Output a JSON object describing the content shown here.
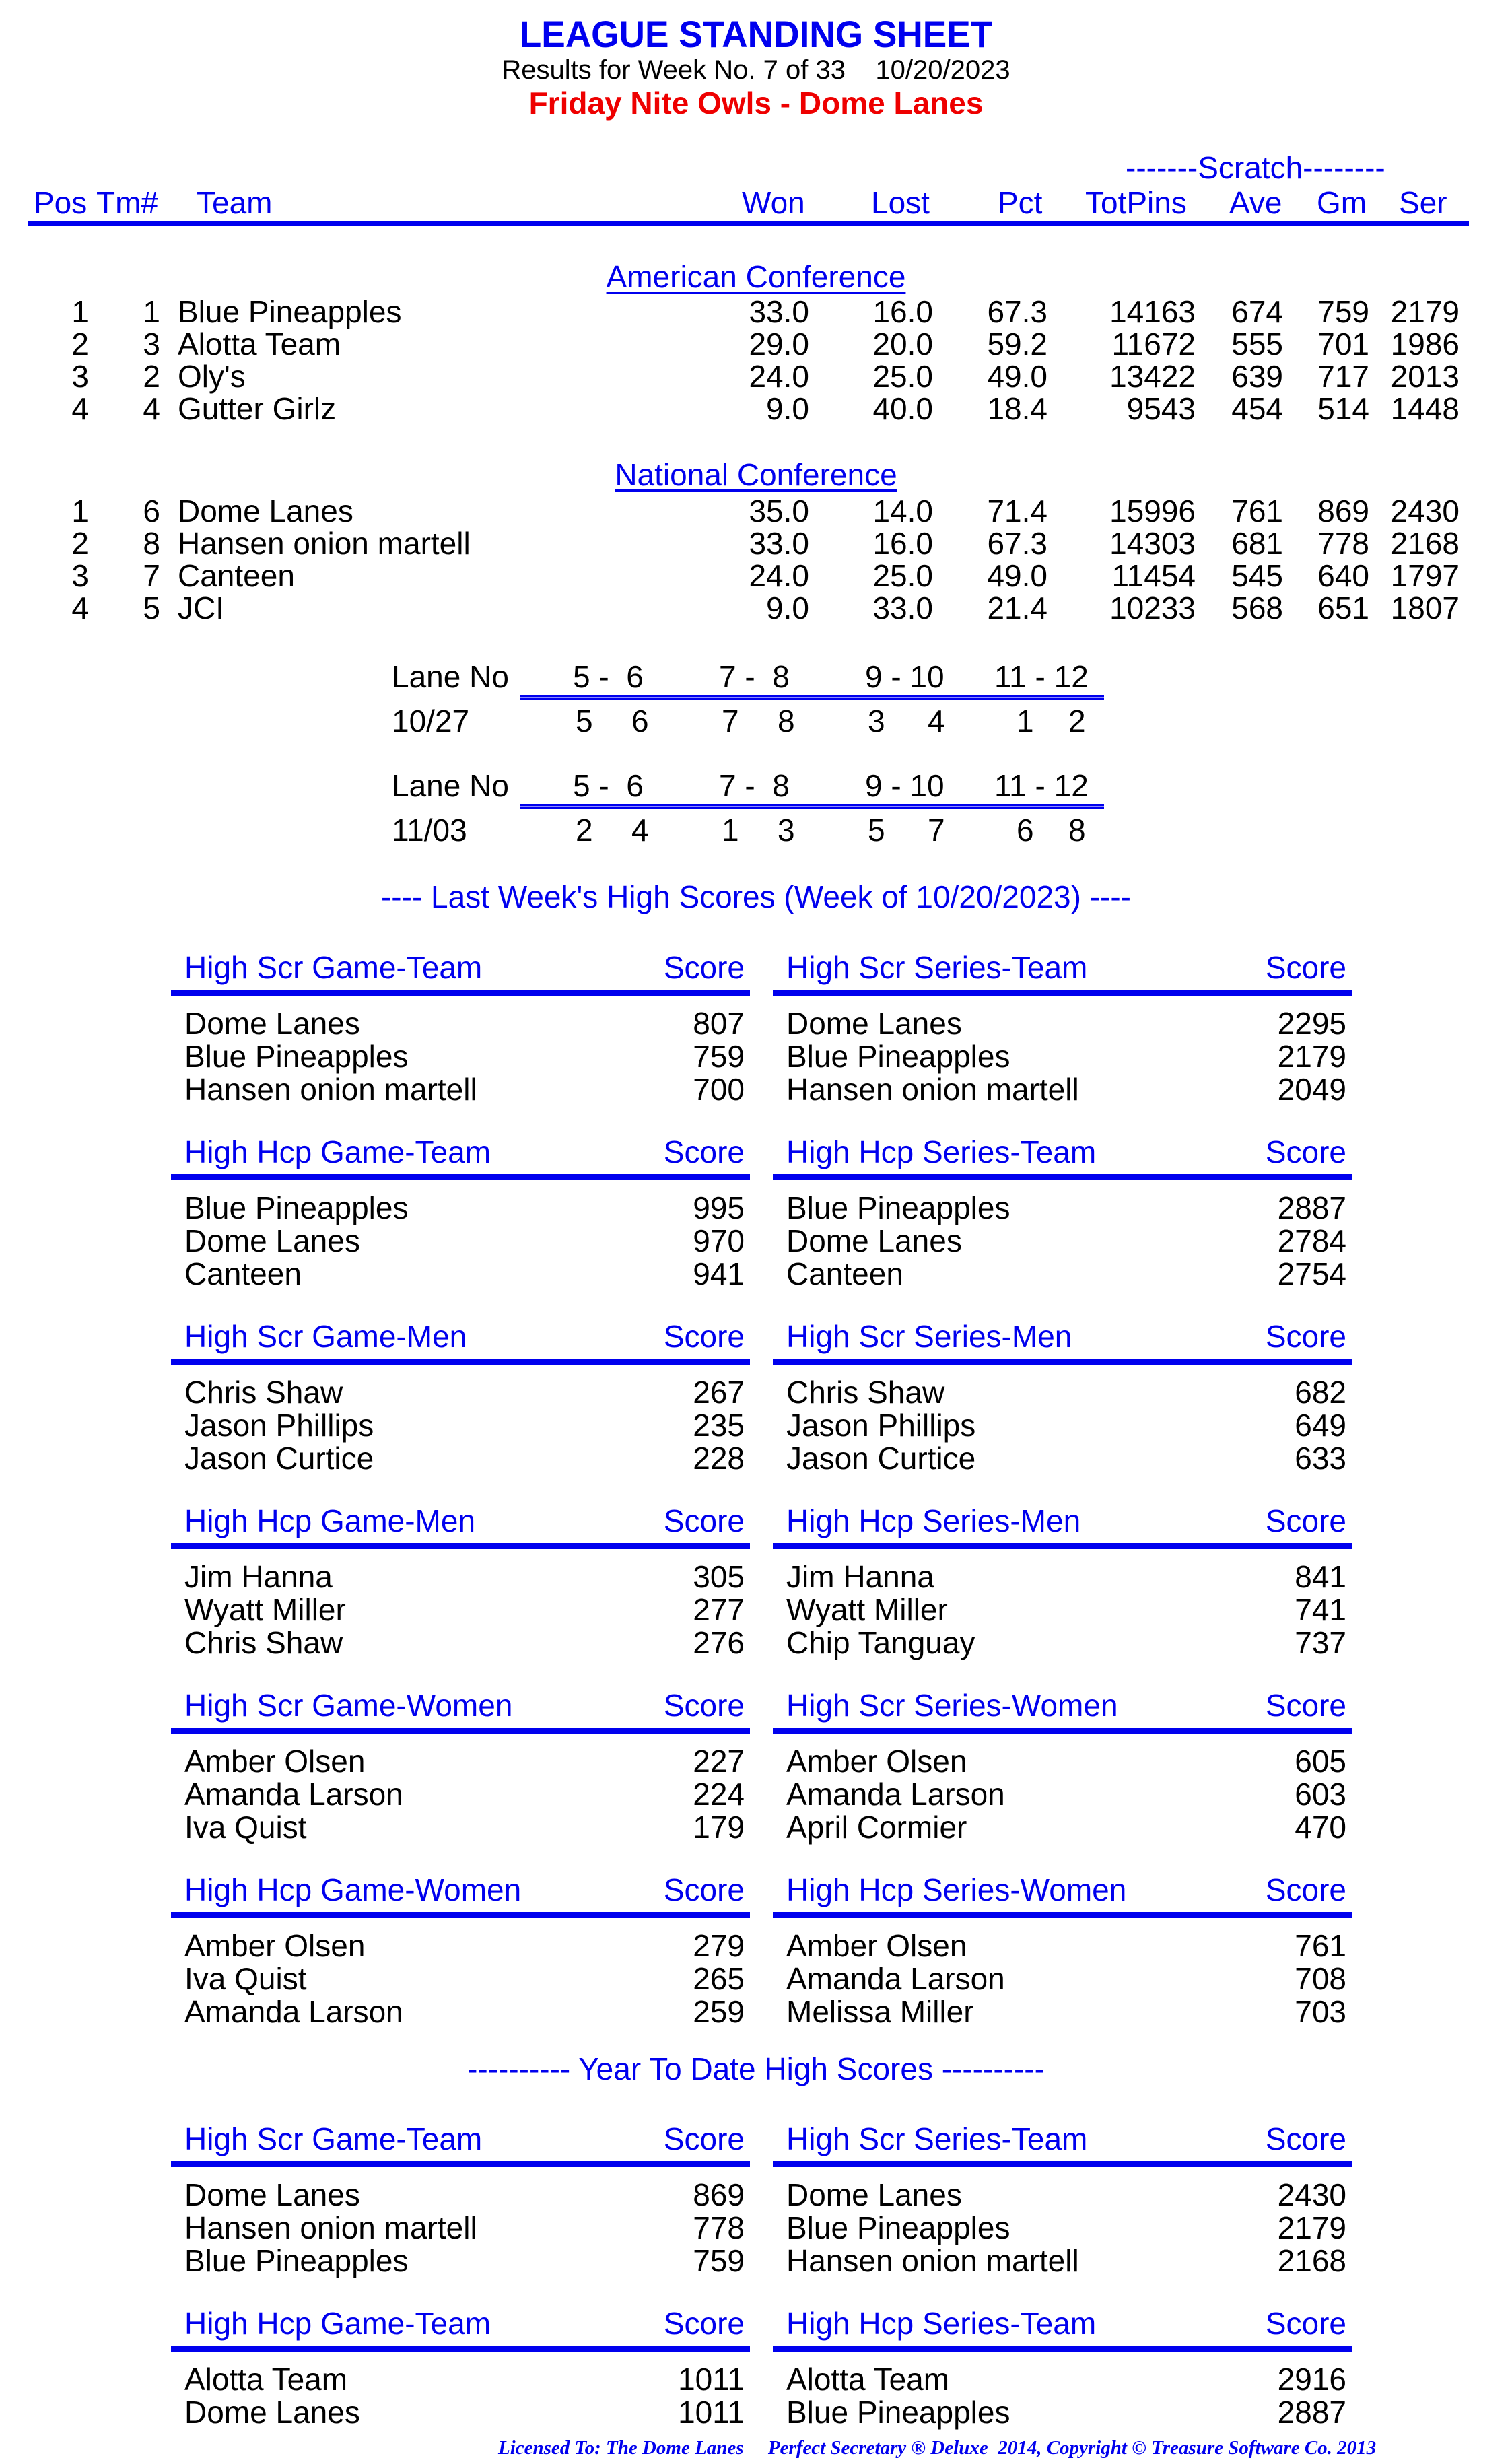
{
  "header": {
    "title": "LEAGUE STANDING SHEET",
    "subtitle": "Results for Week No. 7 of 33    10/20/2023",
    "league_name": "Friday Nite Owls - Dome Lanes"
  },
  "standings": {
    "scratch_label": "-------Scratch--------",
    "columns": {
      "pos": "Pos",
      "tm": "Tm#",
      "team": "Team",
      "won": "Won",
      "lost": "Lost",
      "pct": "Pct",
      "totpins": "TotPins",
      "ave": "Ave",
      "gm": "Gm",
      "ser": "Ser"
    },
    "conferences": [
      {
        "name": "American Conference",
        "rows": [
          {
            "pos": "1",
            "tm": "1",
            "team": "Blue Pineapples",
            "won": "33.0",
            "lost": "16.0",
            "pct": "67.3",
            "totpins": "14163",
            "ave": "674",
            "gm": "759",
            "ser": "2179"
          },
          {
            "pos": "2",
            "tm": "3",
            "team": "Alotta Team",
            "won": "29.0",
            "lost": "20.0",
            "pct": "59.2",
            "totpins": "11672",
            "ave": "555",
            "gm": "701",
            "ser": "1986"
          },
          {
            "pos": "3",
            "tm": "2",
            "team": "Oly's",
            "won": "24.0",
            "lost": "25.0",
            "pct": "49.0",
            "totpins": "13422",
            "ave": "639",
            "gm": "717",
            "ser": "2013"
          },
          {
            "pos": "4",
            "tm": "4",
            "team": "Gutter Girlz",
            "won": "9.0",
            "lost": "40.0",
            "pct": "18.4",
            "totpins": "9543",
            "ave": "454",
            "gm": "514",
            "ser": "1448"
          }
        ]
      },
      {
        "name": "National Conference",
        "rows": [
          {
            "pos": "1",
            "tm": "6",
            "team": "Dome Lanes",
            "won": "35.0",
            "lost": "14.0",
            "pct": "71.4",
            "totpins": "15996",
            "ave": "761",
            "gm": "869",
            "ser": "2430"
          },
          {
            "pos": "2",
            "tm": "8",
            "team": "Hansen onion martell",
            "won": "33.0",
            "lost": "16.0",
            "pct": "67.3",
            "totpins": "14303",
            "ave": "681",
            "gm": "778",
            "ser": "2168"
          },
          {
            "pos": "3",
            "tm": "7",
            "team": "Canteen",
            "won": "24.0",
            "lost": "25.0",
            "pct": "49.0",
            "totpins": "11454",
            "ave": "545",
            "gm": "640",
            "ser": "1797"
          },
          {
            "pos": "4",
            "tm": "5",
            "team": "JCI",
            "won": "9.0",
            "lost": "33.0",
            "pct": "21.4",
            "totpins": "10233",
            "ave": "568",
            "gm": "651",
            "ser": "1807"
          }
        ]
      }
    ]
  },
  "lane_assignments": [
    {
      "label": "Lane No",
      "lanes": [
        "5 -  6",
        "7 -  8",
        "9 - 10",
        "11 - 12"
      ],
      "date": "10/27",
      "pairs": [
        [
          "5",
          "6"
        ],
        [
          "7",
          "8"
        ],
        [
          "3",
          "4"
        ],
        [
          "1",
          "2"
        ]
      ]
    },
    {
      "label": "Lane No",
      "lanes": [
        "5 -  6",
        "7 -  8",
        "9 - 10",
        "11 - 12"
      ],
      "date": "11/03",
      "pairs": [
        [
          "2",
          "4"
        ],
        [
          "1",
          "3"
        ],
        [
          "5",
          "7"
        ],
        [
          "6",
          "8"
        ]
      ]
    }
  ],
  "last_week": {
    "title": "----  Last Week's High Scores   (Week of 10/20/2023)  ----",
    "blocks": [
      {
        "title": "High Scr Game-Team",
        "score_label": "Score",
        "items": [
          {
            "name": "Dome Lanes",
            "score": "807"
          },
          {
            "name": "Blue Pineapples",
            "score": "759"
          },
          {
            "name": "Hansen onion martell",
            "score": "700"
          }
        ]
      },
      {
        "title": "High Scr Series-Team",
        "score_label": "Score",
        "items": [
          {
            "name": "Dome Lanes",
            "score": "2295"
          },
          {
            "name": "Blue Pineapples",
            "score": "2179"
          },
          {
            "name": "Hansen onion martell",
            "score": "2049"
          }
        ]
      },
      {
        "title": "High Hcp Game-Team",
        "score_label": "Score",
        "items": [
          {
            "name": "Blue Pineapples",
            "score": "995"
          },
          {
            "name": "Dome Lanes",
            "score": "970"
          },
          {
            "name": "Canteen",
            "score": "941"
          }
        ]
      },
      {
        "title": "High Hcp Series-Team",
        "score_label": "Score",
        "items": [
          {
            "name": "Blue Pineapples",
            "score": "2887"
          },
          {
            "name": "Dome Lanes",
            "score": "2784"
          },
          {
            "name": "Canteen",
            "score": "2754"
          }
        ]
      },
      {
        "title": "High Scr Game-Men",
        "score_label": "Score",
        "items": [
          {
            "name": "Chris Shaw",
            "score": "267"
          },
          {
            "name": "Jason Phillips",
            "score": "235"
          },
          {
            "name": "Jason Curtice",
            "score": "228"
          }
        ]
      },
      {
        "title": "High Scr Series-Men",
        "score_label": "Score",
        "items": [
          {
            "name": "Chris Shaw",
            "score": "682"
          },
          {
            "name": "Jason Phillips",
            "score": "649"
          },
          {
            "name": "Jason Curtice",
            "score": "633"
          }
        ]
      },
      {
        "title": "High Hcp Game-Men",
        "score_label": "Score",
        "items": [
          {
            "name": "Jim Hanna",
            "score": "305"
          },
          {
            "name": "Wyatt Miller",
            "score": "277"
          },
          {
            "name": "Chris Shaw",
            "score": "276"
          }
        ]
      },
      {
        "title": "High Hcp Series-Men",
        "score_label": "Score",
        "items": [
          {
            "name": "Jim Hanna",
            "score": "841"
          },
          {
            "name": "Wyatt Miller",
            "score": "741"
          },
          {
            "name": "Chip Tanguay",
            "score": "737"
          }
        ]
      },
      {
        "title": "High Scr Game-Women",
        "score_label": "Score",
        "items": [
          {
            "name": "Amber Olsen",
            "score": "227"
          },
          {
            "name": "Amanda Larson",
            "score": "224"
          },
          {
            "name": "Iva Quist",
            "score": "179"
          }
        ]
      },
      {
        "title": "High Scr Series-Women",
        "score_label": "Score",
        "items": [
          {
            "name": "Amber Olsen",
            "score": "605"
          },
          {
            "name": "Amanda Larson",
            "score": "603"
          },
          {
            "name": "April Cormier",
            "score": "470"
          }
        ]
      },
      {
        "title": "High Hcp Game-Women",
        "score_label": "Score",
        "items": [
          {
            "name": "Amber Olsen",
            "score": "279"
          },
          {
            "name": "Iva Quist",
            "score": "265"
          },
          {
            "name": "Amanda Larson",
            "score": "259"
          }
        ]
      },
      {
        "title": "High Hcp Series-Women",
        "score_label": "Score",
        "items": [
          {
            "name": "Amber Olsen",
            "score": "761"
          },
          {
            "name": "Amanda Larson",
            "score": "708"
          },
          {
            "name": "Melissa Miller",
            "score": "703"
          }
        ]
      }
    ]
  },
  "year_to_date": {
    "title": "---------- Year To Date High Scores ----------",
    "blocks": [
      {
        "title": "High Scr Game-Team",
        "score_label": "Score",
        "items": [
          {
            "name": "Dome Lanes",
            "score": "869"
          },
          {
            "name": "Hansen onion martell",
            "score": "778"
          },
          {
            "name": "Blue Pineapples",
            "score": "759"
          }
        ]
      },
      {
        "title": "High Scr Series-Team",
        "score_label": "Score",
        "items": [
          {
            "name": "Dome Lanes",
            "score": "2430"
          },
          {
            "name": "Blue Pineapples",
            "score": "2179"
          },
          {
            "name": "Hansen onion martell",
            "score": "2168"
          }
        ]
      },
      {
        "title": "High Hcp Game-Team",
        "score_label": "Score",
        "items": [
          {
            "name": "Alotta Team",
            "score": "1011"
          },
          {
            "name": "Dome Lanes",
            "score": "1011"
          }
        ]
      },
      {
        "title": "High Hcp Series-Team",
        "score_label": "Score",
        "items": [
          {
            "name": "Alotta Team",
            "score": "2916"
          },
          {
            "name": "Blue Pineapples",
            "score": "2887"
          }
        ]
      }
    ]
  },
  "footer": {
    "text": "Licensed To: The Dome Lanes     Perfect Secretary ® Deluxe  2014, Copyright © Treasure Software Co. 2013"
  }
}
